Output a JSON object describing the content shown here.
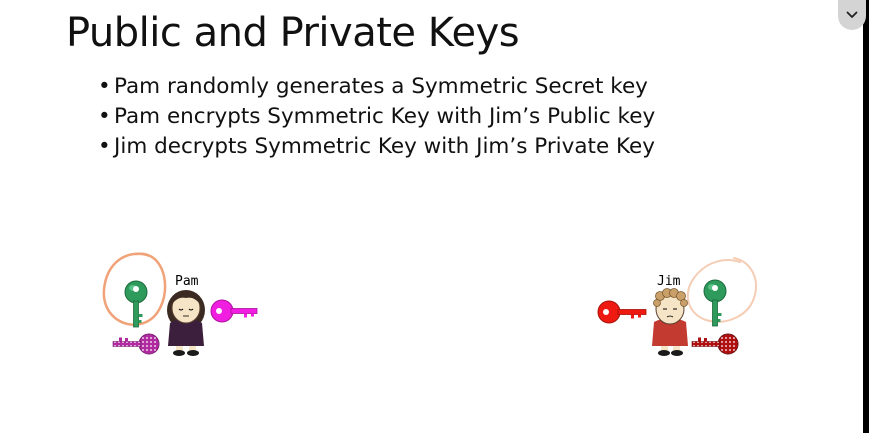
{
  "slide": {
    "title": "Public and Private Keys",
    "bullets": [
      "Pam randomly generates a Symmetric Secret key",
      "Pam encrypts Symmetric Key with Jim’s Public key",
      "Jim decrypts Symmetric Key with Jim’s Private Key"
    ]
  },
  "characters": {
    "pam": {
      "name": "Pam"
    },
    "jim": {
      "name": "Jim"
    }
  },
  "keys": {
    "symmetric_color": "#2e9a5c",
    "pam_public_color": "#f01ee0",
    "pam_private_color": "#b02aa0",
    "jim_public_color": "#ee1a12",
    "jim_private_color": "#b01010"
  },
  "annotations": {
    "circle_color": "#f0a278"
  },
  "icons": {
    "collapse": "chevron-down-icon"
  }
}
